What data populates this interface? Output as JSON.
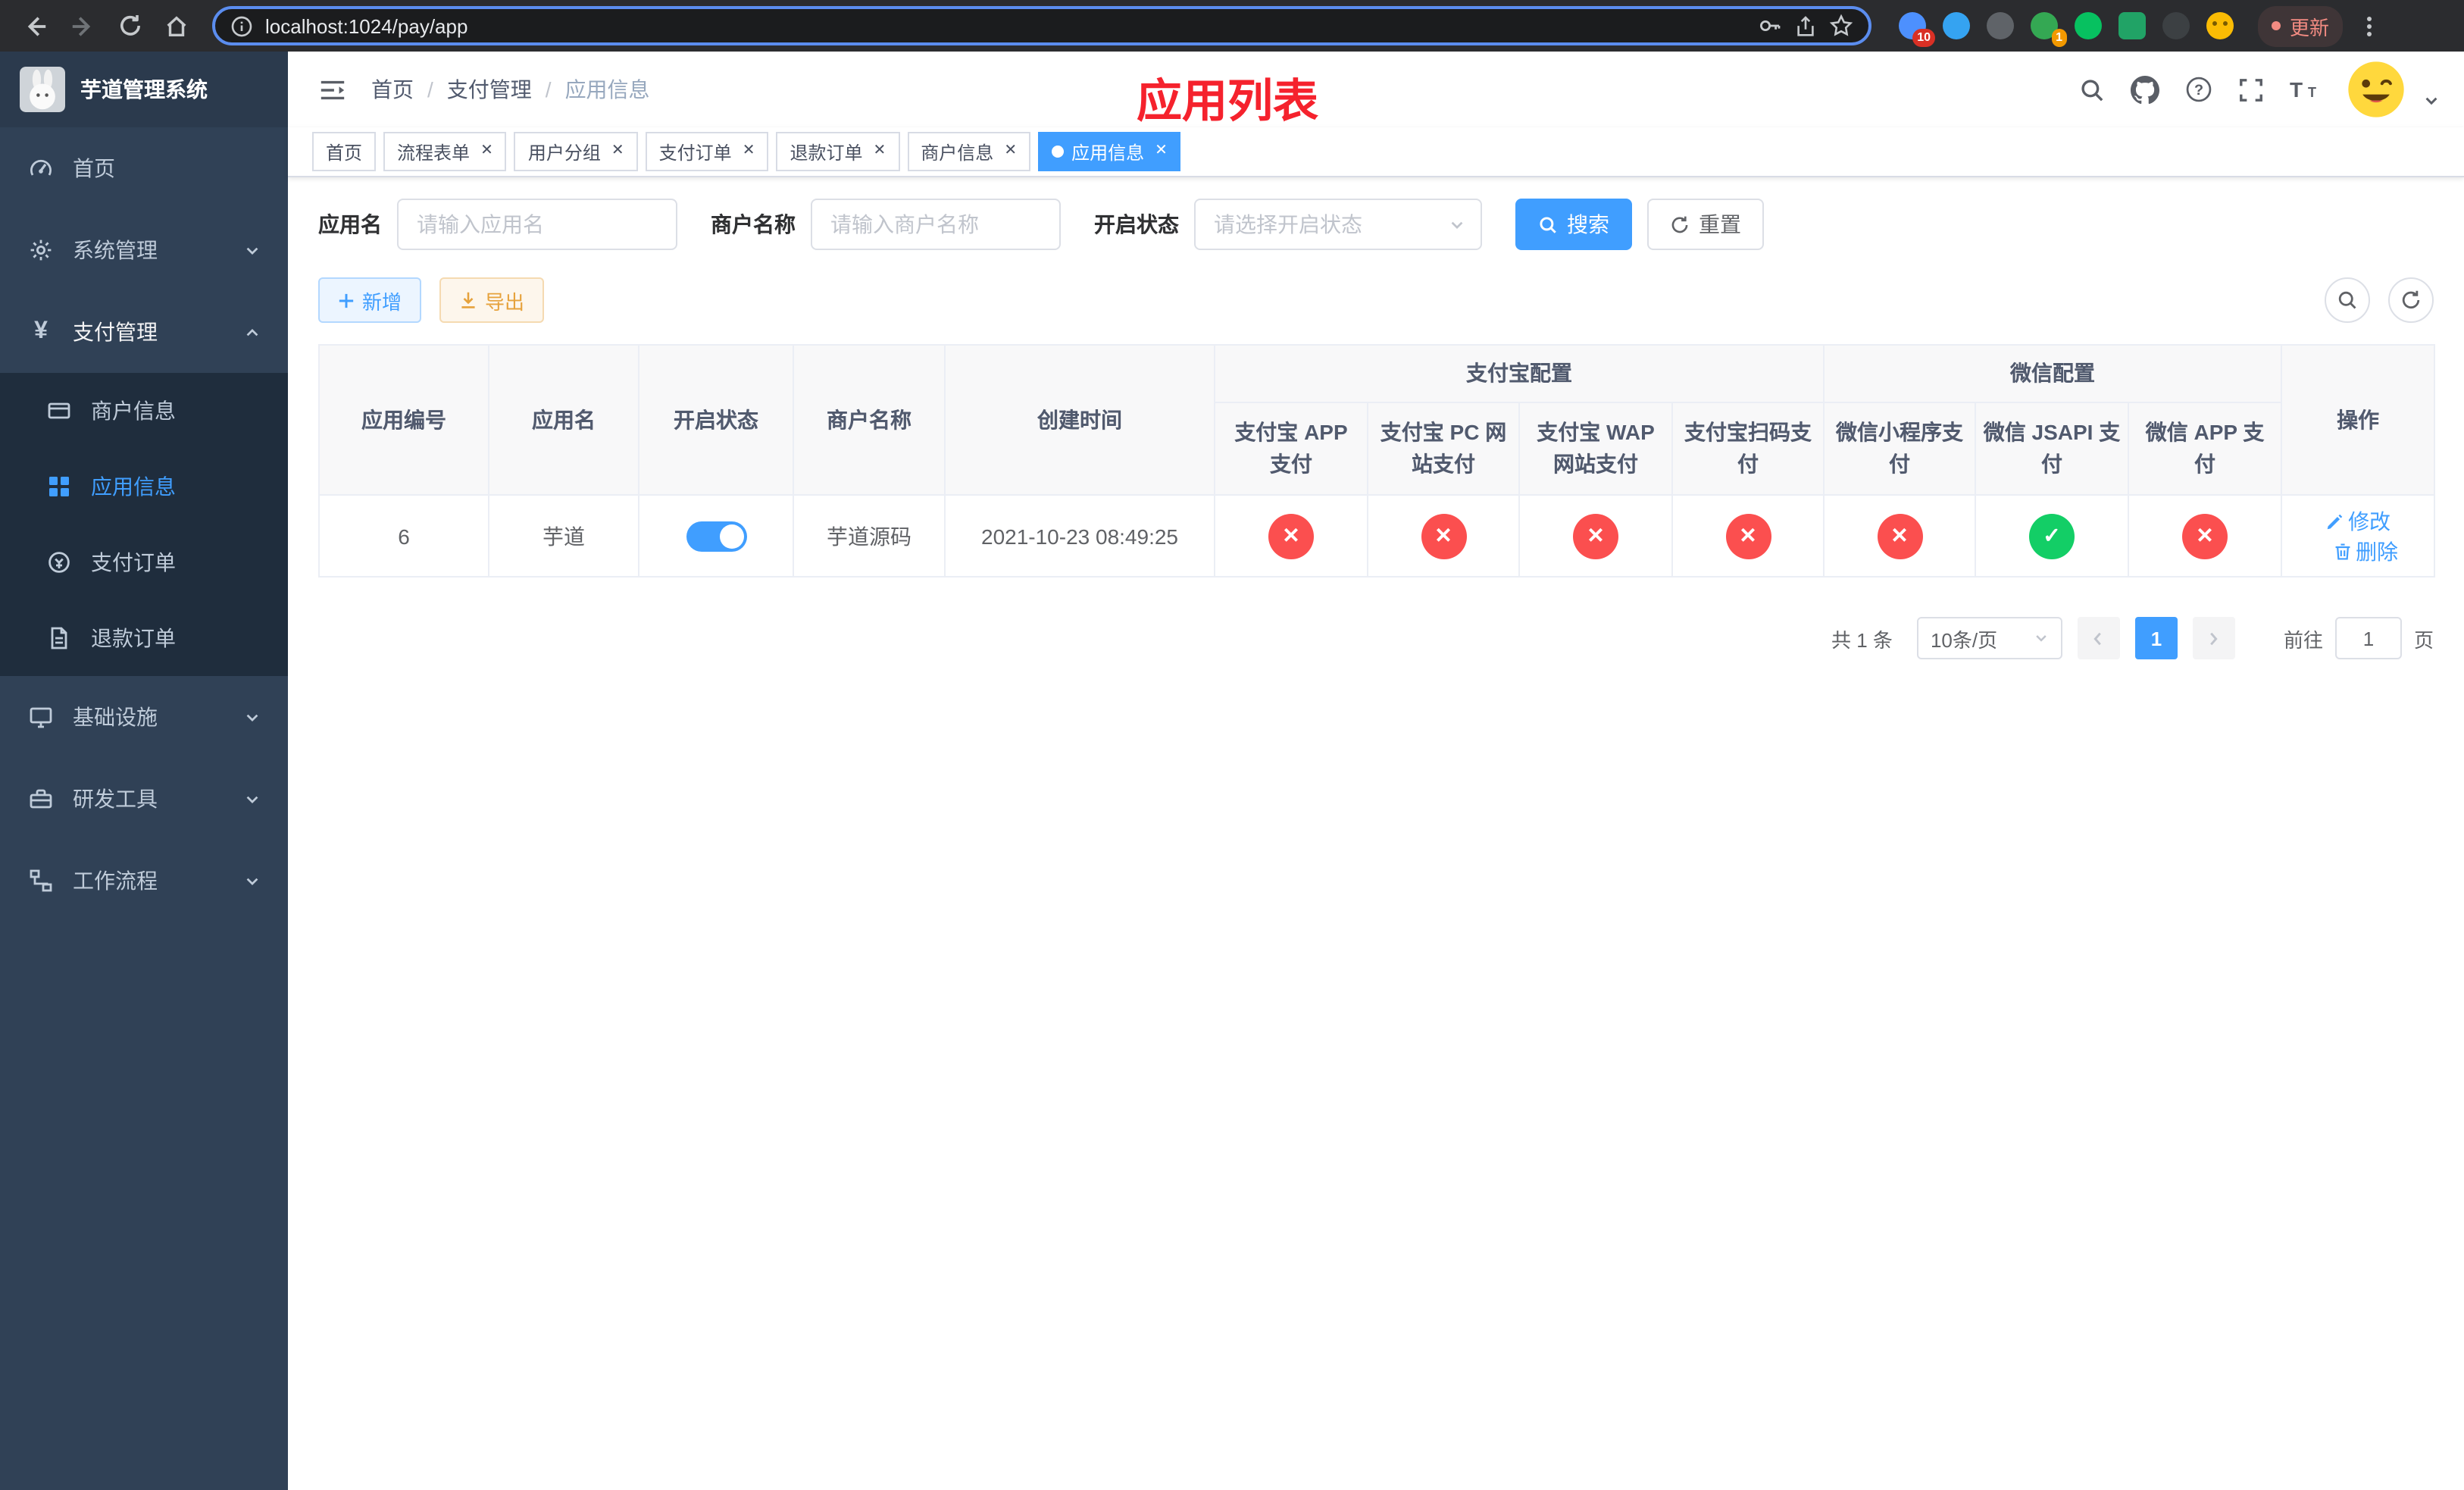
{
  "browser": {
    "url": "localhost:1024/pay/app",
    "update_label": "更新",
    "extension_badges": {
      "first": "10",
      "second": "1"
    }
  },
  "sidebar": {
    "logo_title": "芋道管理系统",
    "items": [
      {
        "label": "首页"
      },
      {
        "label": "系统管理"
      },
      {
        "label": "支付管理"
      },
      {
        "label": "商户信息"
      },
      {
        "label": "应用信息"
      },
      {
        "label": "支付订单"
      },
      {
        "label": "退款订单"
      },
      {
        "label": "基础设施"
      },
      {
        "label": "研发工具"
      },
      {
        "label": "工作流程"
      }
    ]
  },
  "header": {
    "breadcrumb": [
      "首页",
      "支付管理",
      "应用信息"
    ],
    "separator": "/",
    "overlay_title": "应用列表"
  },
  "tabs": [
    {
      "label": "首页"
    },
    {
      "label": "流程表单"
    },
    {
      "label": "用户分组"
    },
    {
      "label": "支付订单"
    },
    {
      "label": "退款订单"
    },
    {
      "label": "商户信息"
    },
    {
      "label": "应用信息"
    }
  ],
  "filters": {
    "app_name_label": "应用名",
    "app_name_placeholder": "请输入应用名",
    "merchant_label": "商户名称",
    "merchant_placeholder": "请输入商户名称",
    "status_label": "开启状态",
    "status_placeholder": "请选择开启状态",
    "search_label": "搜索",
    "reset_label": "重置"
  },
  "toolbar": {
    "add_label": "新增",
    "export_label": "导出"
  },
  "table": {
    "columns": {
      "app_id": "应用编号",
      "app_name": "应用名",
      "status": "开启状态",
      "merchant": "商户名称",
      "created": "创建时间",
      "alipay_group": "支付宝配置",
      "alipay_app": "支付宝 APP 支付",
      "alipay_pc": "支付宝 PC 网站支付",
      "alipay_wap": "支付宝 WAP 网站支付",
      "alipay_qr": "支付宝扫码支付",
      "wechat_group": "微信配置",
      "wechat_mini": "微信小程序支付",
      "wechat_jsapi": "微信 JSAPI 支付",
      "wechat_app": "微信 APP 支付",
      "actions": "操作"
    },
    "rows": [
      {
        "app_id": "6",
        "app_name": "芋道",
        "status": "on",
        "merchant": "芋道源码",
        "created": "2021-10-23 08:49:25",
        "alipay_app": "no",
        "alipay_pc": "no",
        "alipay_wap": "no",
        "alipay_qr": "no",
        "wechat_mini": "no",
        "wechat_jsapi": "yes",
        "wechat_app": "no",
        "edit_label": "修改",
        "delete_label": "删除"
      }
    ]
  },
  "pagination": {
    "total_text": "共 1 条",
    "page_size": "10条/页",
    "current_page": "1",
    "goto_label": "前往",
    "goto_value": "1",
    "page_unit": "页"
  },
  "colors": {
    "accent": "#409eff",
    "success": "#13ce66",
    "danger": "#fb4f4f",
    "warning": "#e6a23c",
    "overlay_title_red": "#f5222d",
    "sidebar_bg": "#304156",
    "submenu_bg": "#1f2d3d"
  }
}
